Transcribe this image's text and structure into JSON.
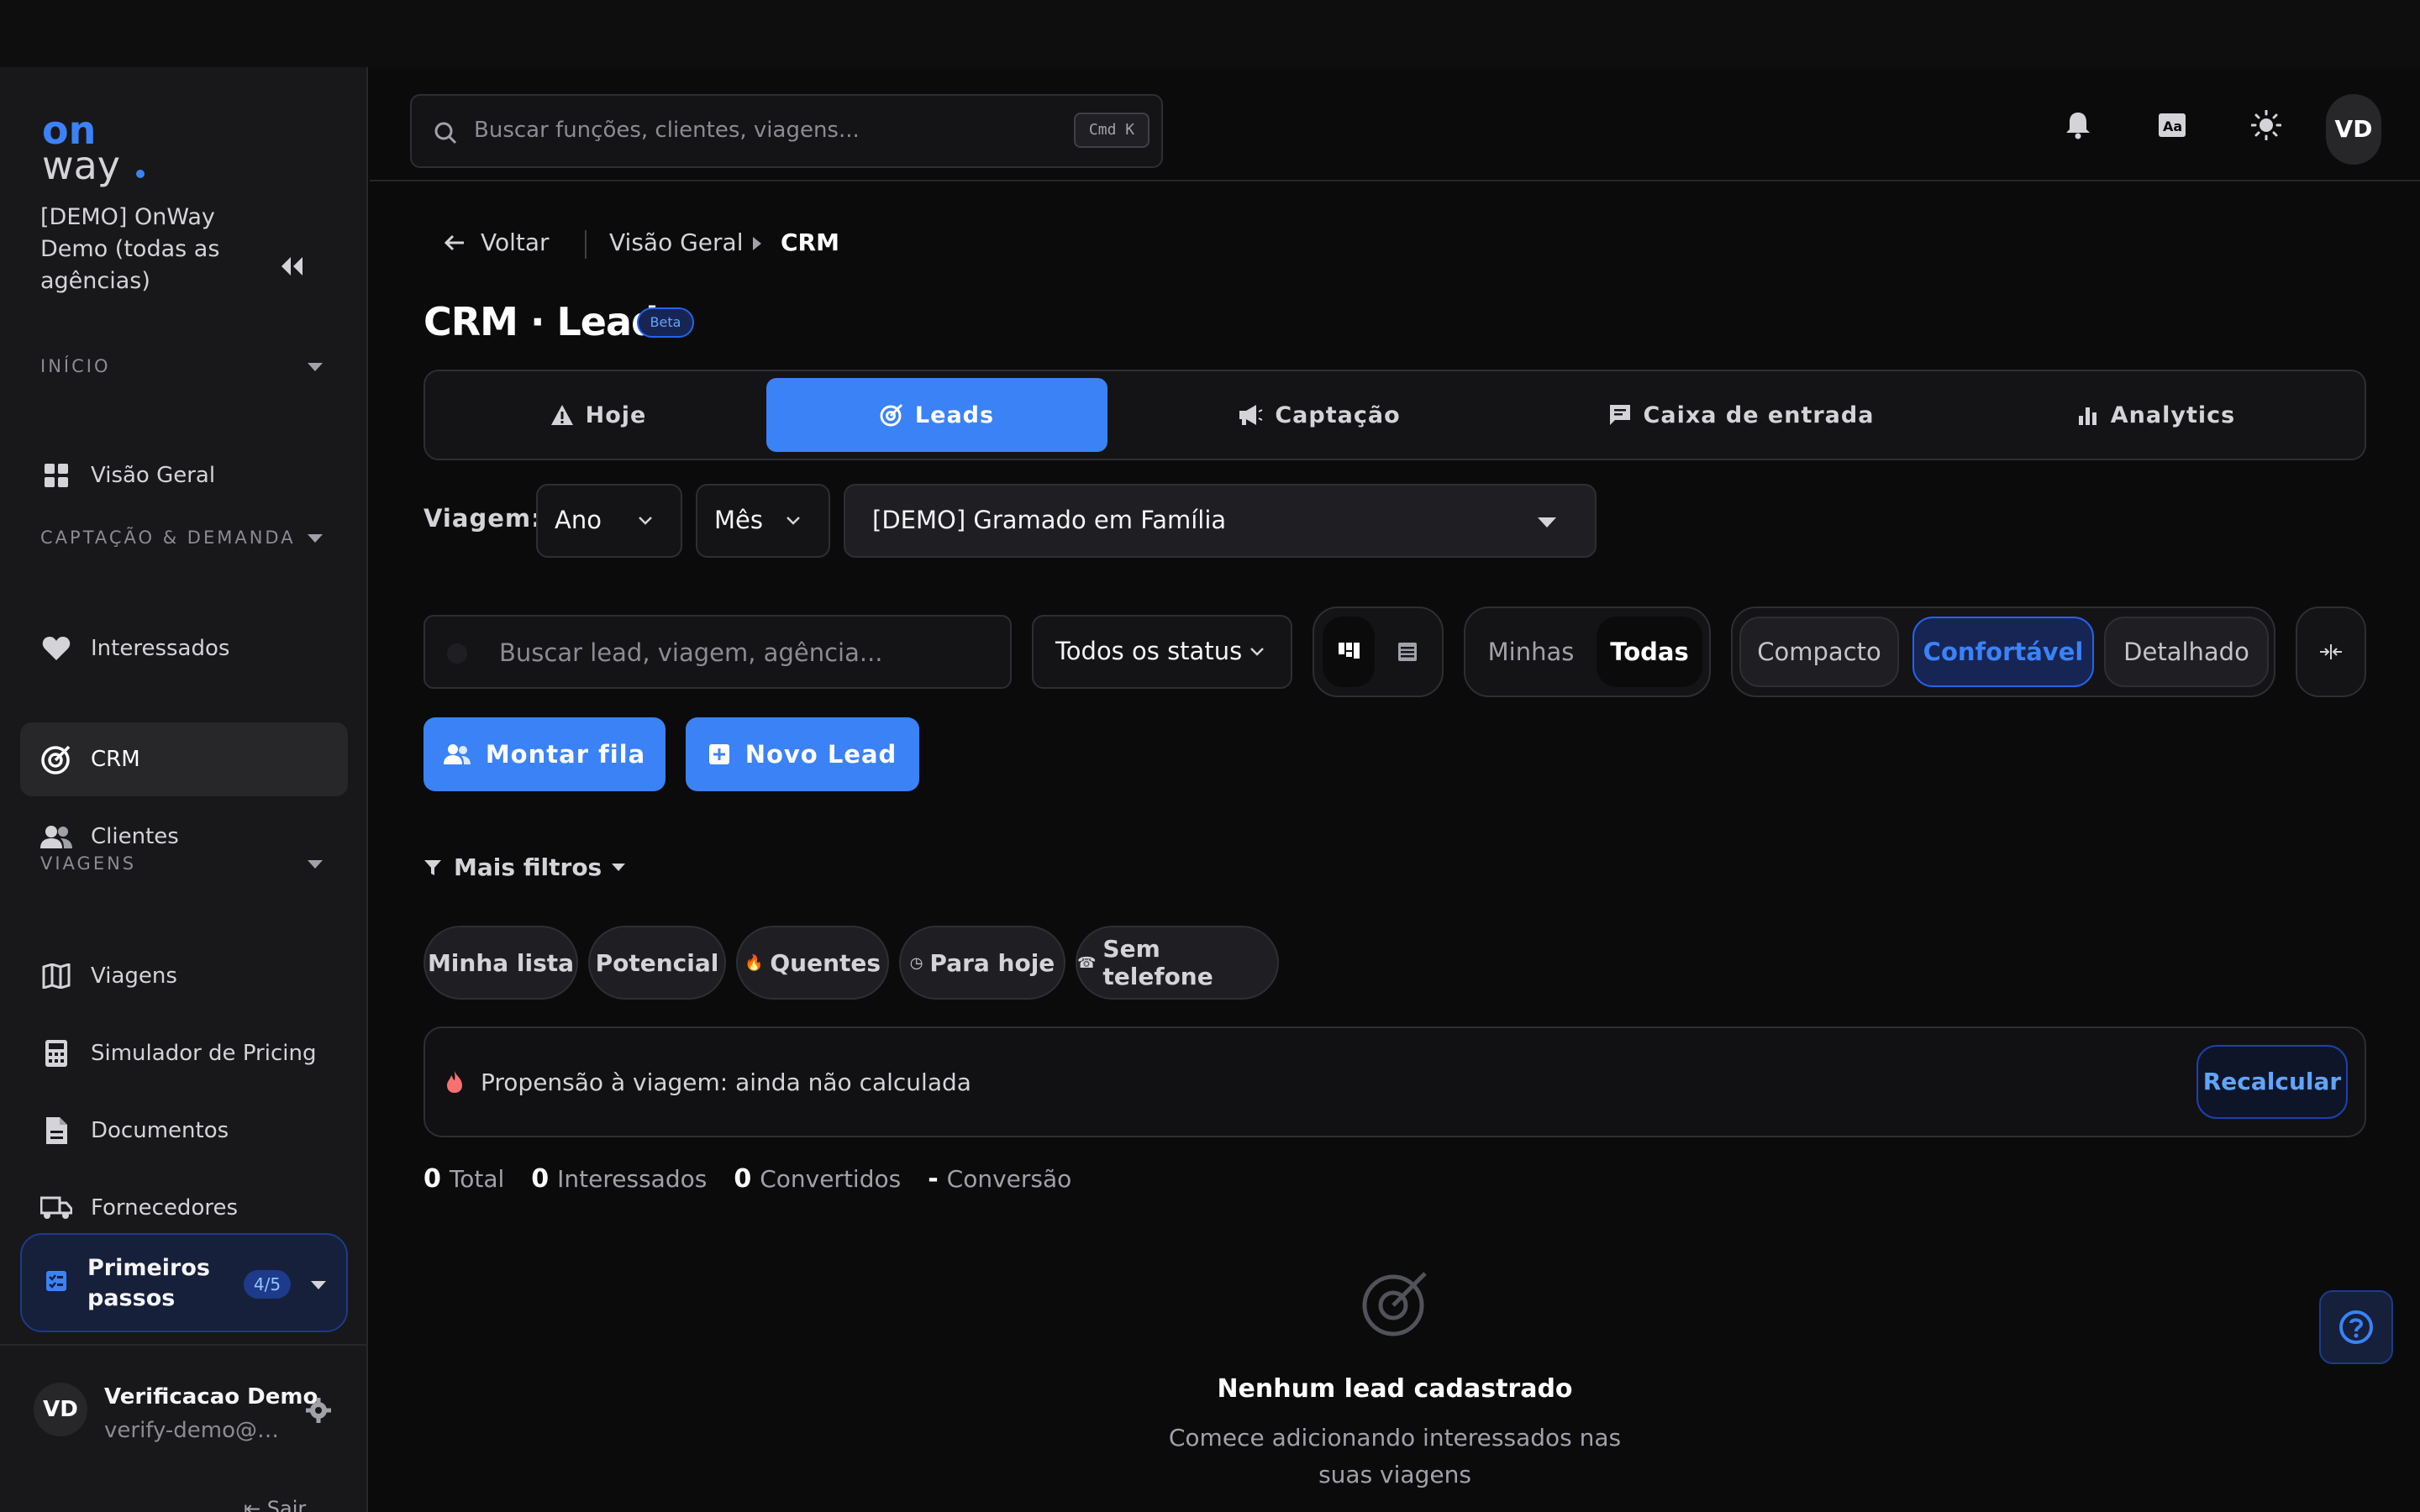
{
  "sidebar": {
    "logo_top": "on",
    "logo_bottom": "way",
    "org_name": "[DEMO] OnWay Demo (todas as agências)",
    "sections": {
      "inicio": "INÍCIO",
      "captacao": "CAPTAÇÃO & DEMANDA",
      "viagens": "VIAGENS"
    },
    "items": [
      {
        "label": "Visão Geral",
        "icon": "grid-icon"
      },
      {
        "label": "Interessados",
        "icon": "heart-icon"
      },
      {
        "label": "CRM",
        "icon": "target-icon",
        "active": true
      },
      {
        "label": "Clientes",
        "icon": "users-icon"
      },
      {
        "label": "Viagens",
        "icon": "map-icon"
      },
      {
        "label": "Simulador de Pricing",
        "icon": "calculator-icon"
      },
      {
        "label": "Documentos",
        "icon": "document-icon"
      },
      {
        "label": "Fornecedores",
        "icon": "truck-icon"
      }
    ],
    "first_steps": {
      "label": "Primeiros passos",
      "progress": "4/5"
    },
    "user": {
      "initials": "VD",
      "name": "Verificacao Demo",
      "email": "verify-demo@o..."
    },
    "logout": "Sair"
  },
  "header": {
    "search_placeholder": "Buscar funções, clientes, viagens...",
    "shortcut": "Cmd K",
    "avatar": "VD"
  },
  "breadcrumb": {
    "back": "Voltar",
    "items": [
      "Visão Geral",
      "CRM"
    ]
  },
  "page": {
    "title": "CRM · Leads",
    "badge": "Beta"
  },
  "tabs": [
    {
      "label": "Hoje",
      "icon": "warning-icon"
    },
    {
      "label": "Leads",
      "icon": "target-icon",
      "active": true
    },
    {
      "label": "Captação",
      "icon": "megaphone-icon"
    },
    {
      "label": "Caixa de entrada",
      "icon": "message-icon"
    },
    {
      "label": "Analytics",
      "icon": "bar-chart-icon"
    }
  ],
  "filters": {
    "viagem_label": "Viagem:",
    "ano": "Ano",
    "mes": "Mês",
    "trip": "[DEMO] Gramado em Família",
    "lead_search_placeholder": "Buscar lead, viagem, agência...",
    "status": "Todos os status",
    "scope": [
      "Minhas",
      "Todas"
    ],
    "scope_selected": "Todas",
    "density": [
      "Compacto",
      "Confortável",
      "Detalhado"
    ],
    "density_selected": "Confortável",
    "more_filters": "Mais filtros"
  },
  "actions": {
    "queue": "Montar fila",
    "new_lead": "Novo Lead"
  },
  "chips": [
    {
      "label": "Minha lista",
      "icon": ""
    },
    {
      "label": "Potencial",
      "icon": ""
    },
    {
      "label": "Quentes",
      "icon": "🔥"
    },
    {
      "label": "Para hoje",
      "icon": "◷"
    },
    {
      "label": "Sem telefone",
      "icon": "☎"
    }
  ],
  "propensity": {
    "text": "Propensão à viagem: ainda não calculada",
    "button": "Recalcular"
  },
  "stats": [
    {
      "value": "0",
      "label": "Total"
    },
    {
      "value": "0",
      "label": "Interessados"
    },
    {
      "value": "0",
      "label": "Convertidos"
    },
    {
      "value": "-",
      "label": "Conversão"
    }
  ],
  "empty": {
    "title": "Nenhum lead cadastrado",
    "subtitle": "Comece adicionando interessados nas suas viagens"
  },
  "colors": {
    "accent": "#3b82f6",
    "background": "#0b0b0c",
    "sidebar": "#18181b"
  }
}
